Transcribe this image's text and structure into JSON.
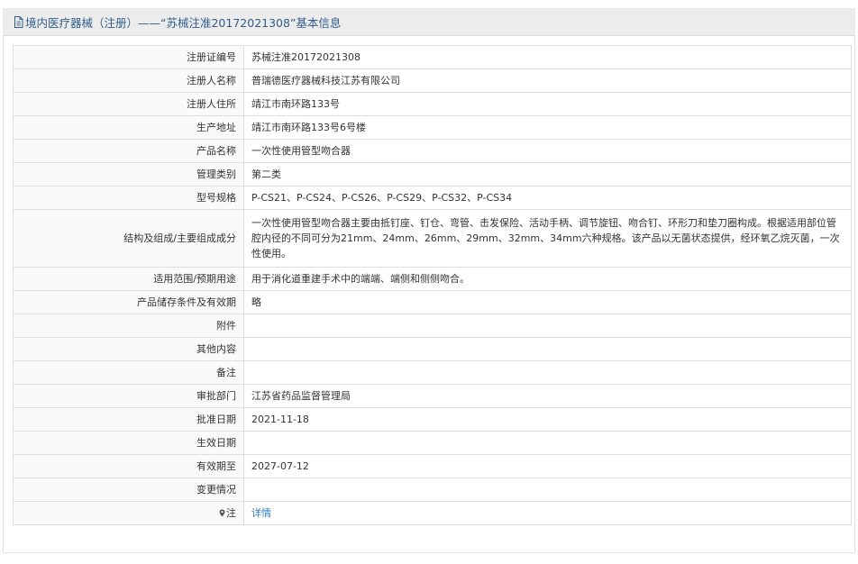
{
  "header": {
    "title": "境内医疗器械（注册）——“苏械注准20172021308”基本信息"
  },
  "rows": [
    {
      "label": "注册证编号",
      "value": "苏械注准20172021308"
    },
    {
      "label": "注册人名称",
      "value": "普瑞德医疗器械科技江苏有限公司"
    },
    {
      "label": "注册人住所",
      "value": "靖江市南环路133号"
    },
    {
      "label": "生产地址",
      "value": "靖江市南环路133号6号楼"
    },
    {
      "label": "产品名称",
      "value": "一次性使用管型吻合器"
    },
    {
      "label": "管理类别",
      "value": "第二类"
    },
    {
      "label": "型号规格",
      "value": "P-CS21、P-CS24、P-CS26、P-CS29、P-CS32、P-CS34"
    },
    {
      "label": "结构及组成/主要组成成分",
      "value": "一次性使用管型吻合器主要由抵钉座、钉仓、弯管、击发保险、活动手柄、调节旋钮、吻合钉、环形刀和垫刀圈构成。根据适用部位管腔内径的不同可分为21mm、24mm、26mm、29mm、32mm、34mm六种规格。该产品以无菌状态提供，经环氧乙烷灭菌，一次性使用。"
    },
    {
      "label": "适用范围/预期用途",
      "value": "用于消化道重建手术中的端端、端侧和侧侧吻合。"
    },
    {
      "label": "产品储存条件及有效期",
      "value": "略"
    },
    {
      "label": "附件",
      "value": ""
    },
    {
      "label": "其他内容",
      "value": ""
    },
    {
      "label": "备注",
      "value": ""
    },
    {
      "label": "审批部门",
      "value": "江苏省药品监督管理局"
    },
    {
      "label": "批准日期",
      "value": "2021-11-18"
    },
    {
      "label": "生效日期",
      "value": ""
    },
    {
      "label": "有效期至",
      "value": "2027-07-12"
    },
    {
      "label": "变更情况",
      "value": ""
    },
    {
      "label": "注",
      "value": "详情"
    }
  ],
  "icons": {
    "header_icon": "document-icon",
    "note_icon": "map-pin-icon"
  },
  "colors": {
    "header_title": "#2f5d8a",
    "link": "#2f7bbf"
  }
}
